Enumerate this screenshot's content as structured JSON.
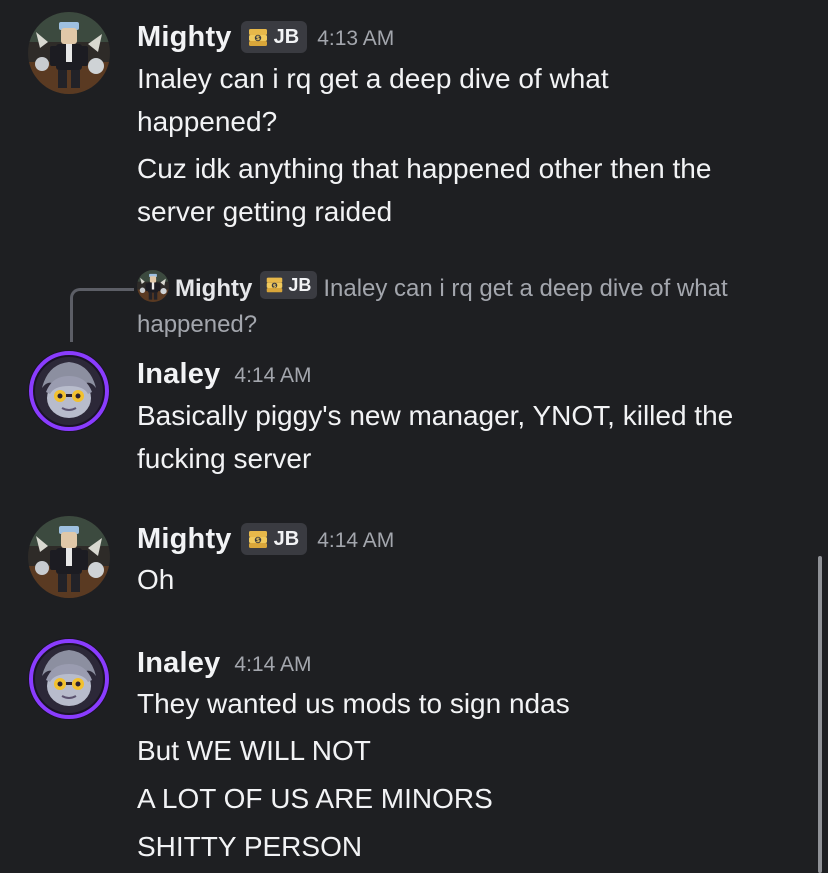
{
  "messages": [
    {
      "author": "Mighty",
      "tag": "JB",
      "time": "4:13 AM",
      "lines": [
        "Inaley can i rq get a deep dive of what",
        "happened?",
        "Cuz idk anything that happened other then the",
        "server getting raided"
      ]
    },
    {
      "reply": {
        "author": "Mighty",
        "tag": "JB",
        "text": "Inaley can i rq get a deep dive of what happened?"
      },
      "author": "Inaley",
      "time": "4:14 AM",
      "lines": [
        "Basically piggy's new manager, YNOT, killed the",
        "fucking server"
      ]
    },
    {
      "author": "Mighty",
      "tag": "JB",
      "time": "4:14 AM",
      "lines": [
        "Oh"
      ]
    },
    {
      "author": "Inaley",
      "time": "4:14 AM",
      "lines": [
        "They wanted us mods to sign ndas",
        "But WE WILL NOT",
        "A LOT OF US ARE MINORS",
        "SHITTY PERSON"
      ]
    }
  ],
  "colors": {
    "background": "#1e1f22",
    "text": "#f2f3f5",
    "muted": "#a3a6ad",
    "tag_bg": "#3a3b41",
    "avatar_ring": "#8a3cff"
  },
  "icons": {
    "tag": "money-stack-icon",
    "mighty_avatar": "roblox-avatar",
    "inaley_avatar": "anime-avatar"
  }
}
